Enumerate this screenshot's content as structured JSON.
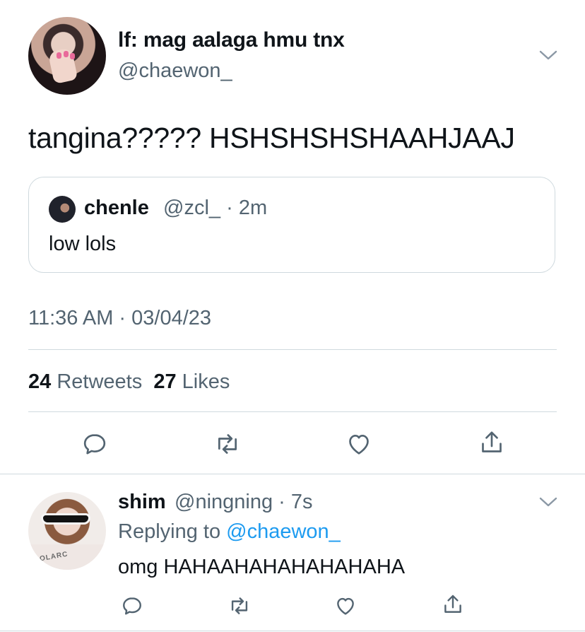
{
  "main_tweet": {
    "display_name": "lf: mag aalaga hmu tnx",
    "handle": "@chaewon_",
    "text": "tangina????? HSHSHSHSHAAHJAAJ",
    "timestamp": "11:36 AM · 03/04/23",
    "stats": {
      "retweets_count": "24",
      "retweets_label": "Retweets",
      "likes_count": "27",
      "likes_label": "Likes"
    }
  },
  "quoted_tweet": {
    "display_name": "chenle",
    "handle": "@zcl_",
    "separator": "·",
    "time": "2m",
    "text": "low lols"
  },
  "reply": {
    "display_name": "shim",
    "handle": "@ningning",
    "separator": "·",
    "time": "7s",
    "replying_to_label": "Replying to",
    "replying_to_handle": "@chaewon_",
    "text": "omg HAHAAHAHAHAHAHAHA",
    "avatar_shirt_text": "OLARC"
  },
  "icons": {
    "menu": "chevron-down-icon",
    "reply": "reply-icon",
    "retweet": "retweet-icon",
    "like": "like-icon",
    "share": "share-icon"
  },
  "colors": {
    "text_primary": "#0f1419",
    "text_secondary": "#536471",
    "link": "#1d9bf0",
    "divider": "#cfd9de"
  }
}
